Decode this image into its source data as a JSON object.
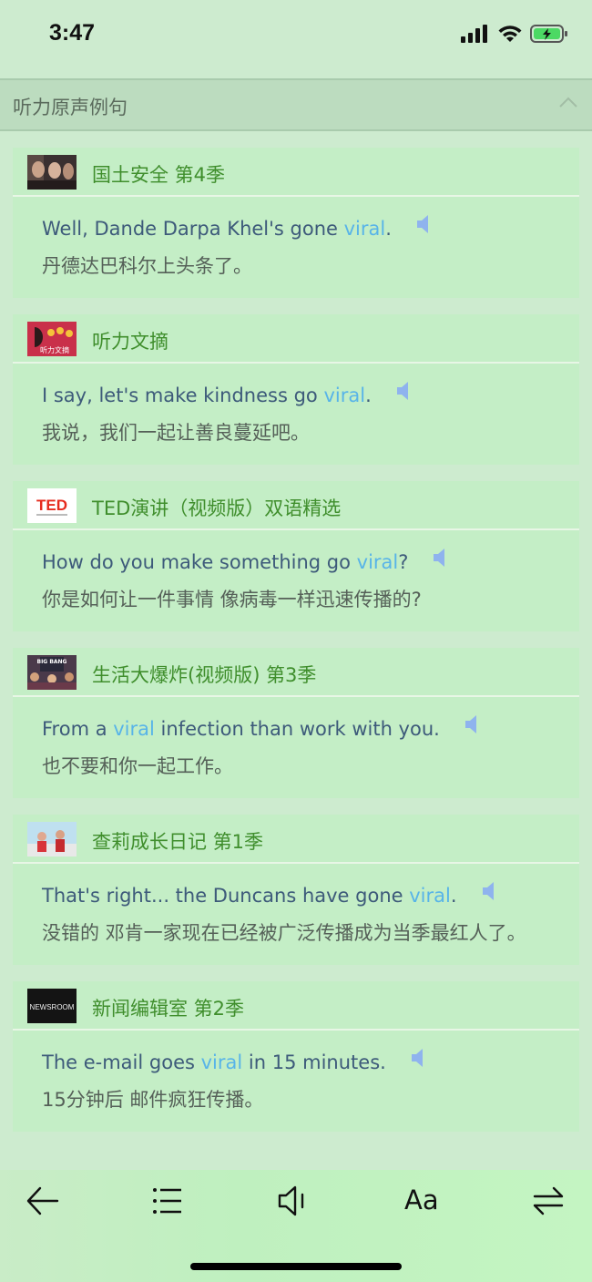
{
  "status": {
    "time": "3:47"
  },
  "section": {
    "title": "听力原声例句"
  },
  "items": [
    {
      "source": "国土安全 第4季",
      "en_before": "Well, Dande Darpa Khel's gone ",
      "keyword": "viral",
      "en_after": ".",
      "zh": "丹德达巴科尔上头条了。"
    },
    {
      "source": "听力文摘",
      "thumb_text": "听力文摘",
      "en_before": "I say, let's make kindness go ",
      "keyword": "viral",
      "en_after": ".",
      "zh": "我说，我们一起让善良蔓延吧。"
    },
    {
      "source": "TED演讲（视频版）双语精选",
      "thumb_text": "TED",
      "en_before": "How do you make something go ",
      "keyword": "viral",
      "en_after": "?",
      "zh": "你是如何让一件事情 像病毒一样迅速传播的?"
    },
    {
      "source": "生活大爆炸(视频版) 第3季",
      "thumb_text": "BIG BANG",
      "en_before": "From a ",
      "keyword": "viral",
      "en_after": " infection than work with you.",
      "zh": "也不要和你一起工作。"
    },
    {
      "source": "查莉成长日记 第1季",
      "en_before": "That's right... the Duncans have gone ",
      "keyword": "viral",
      "en_after": ".",
      "zh": "没错的 邓肯一家现在已经被广泛传播成为当季最红人了。"
    },
    {
      "source": "新闻编辑室 第2季",
      "thumb_text": "NEWSROOM",
      "en_before": "The e-mail goes ",
      "keyword": "viral",
      "en_after": " in 15 minutes.",
      "zh": "15分钟后 邮件疯狂传播。"
    }
  ],
  "toolbar": {
    "font_label": "Aa"
  },
  "colors": {
    "source_green": "#3f8e2c",
    "keyword_blue": "#58b4e8",
    "speaker_blue": "#8fb3ee"
  }
}
